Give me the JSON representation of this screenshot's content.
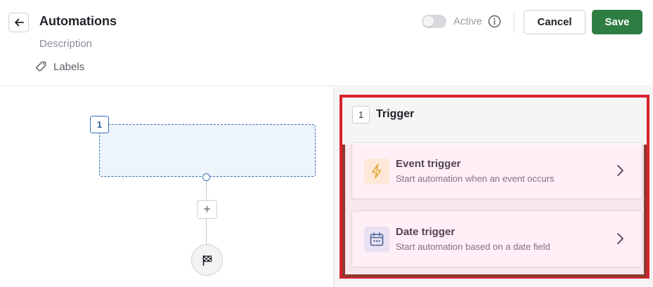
{
  "header": {
    "title": "Automations",
    "description_placeholder": "Description",
    "labels_label": "Labels",
    "active_label": "Active",
    "active_on": false,
    "cancel_label": "Cancel",
    "save_label": "Save"
  },
  "canvas": {
    "step_number": "1",
    "add_step_symbol": "+",
    "icons": {
      "finish": "checkered-flag-icon"
    }
  },
  "panel": {
    "step_number": "1",
    "title": "Trigger",
    "options": [
      {
        "title": "Event trigger",
        "subtitle": "Start automation when an event occurs",
        "icon": "lightning-bolt-icon"
      },
      {
        "title": "Date trigger",
        "subtitle": "Start automation based on a date field",
        "icon": "calendar-icon"
      }
    ]
  },
  "colors": {
    "save_bg": "#2e7d42",
    "accent_blue": "#3a6fb5",
    "placeholder_bg": "#eef4fc",
    "panel_bg": "#f5f5f5",
    "highlight_red": "#d8202b",
    "highlight_brown": "#8b3a2e",
    "event_icon_bg": "#fdf6d8",
    "date_icon_bg": "#e3eef9"
  }
}
